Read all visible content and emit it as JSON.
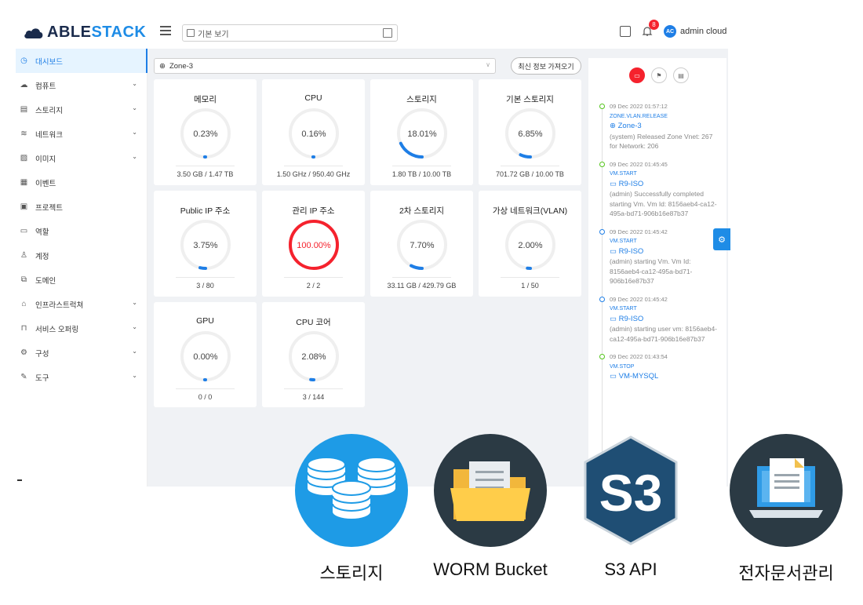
{
  "brand": {
    "logo_part1": "ABLE",
    "logo_part2": "STACK"
  },
  "topbar": {
    "view_label": "기본 보기",
    "notification_count": "8",
    "avatar_initials": "AC",
    "user_name": "admin cloud"
  },
  "sidebar": {
    "items": [
      {
        "label": "대시보드",
        "icon": "dashboard-icon",
        "active": true,
        "expandable": false
      },
      {
        "label": "컴퓨트",
        "icon": "cloud-icon",
        "expandable": true
      },
      {
        "label": "스토리지",
        "icon": "storage-icon",
        "expandable": true
      },
      {
        "label": "네트워크",
        "icon": "wifi-icon",
        "expandable": true
      },
      {
        "label": "이미지",
        "icon": "image-icon",
        "expandable": true
      },
      {
        "label": "이벤트",
        "icon": "calendar-icon",
        "expandable": false
      },
      {
        "label": "프로젝트",
        "icon": "project-icon",
        "expandable": false
      },
      {
        "label": "역할",
        "icon": "role-icon",
        "expandable": false
      },
      {
        "label": "계정",
        "icon": "account-icon",
        "expandable": false
      },
      {
        "label": "도메인",
        "icon": "domain-icon",
        "expandable": false
      },
      {
        "label": "인프라스트럭쳐",
        "icon": "bank-icon",
        "expandable": true
      },
      {
        "label": "서비스 오퍼링",
        "icon": "shopping-icon",
        "expandable": true
      },
      {
        "label": "구성",
        "icon": "gear-icon",
        "expandable": true
      },
      {
        "label": "도구",
        "icon": "tool-icon",
        "expandable": true
      }
    ]
  },
  "main": {
    "zone": "Zone-3",
    "refresh_label": "최신 정보 가져오기",
    "cards": [
      {
        "title": "메모리",
        "value": "0.23%",
        "percent": 0.23,
        "footer": "3.50 GB / 1.47 TB",
        "critical": false
      },
      {
        "title": "CPU",
        "value": "0.16%",
        "percent": 0.16,
        "footer": "1.50 GHz / 950.40 GHz",
        "critical": false
      },
      {
        "title": "스토리지",
        "value": "18.01%",
        "percent": 18.01,
        "footer": "1.80 TB / 10.00 TB",
        "critical": false
      },
      {
        "title": "기본 스토리지",
        "value": "6.85%",
        "percent": 6.85,
        "footer": "701.72 GB / 10.00 TB",
        "critical": false
      },
      {
        "title": "Public IP 주소",
        "value": "3.75%",
        "percent": 3.75,
        "footer": "3 / 80",
        "critical": false
      },
      {
        "title": "관리 IP 주소",
        "value": "100.00%",
        "percent": 100,
        "footer": "2 / 2",
        "critical": true
      },
      {
        "title": "2차 스토리지",
        "value": "7.70%",
        "percent": 7.7,
        "footer": "33.11 GB / 429.79 GB",
        "critical": false
      },
      {
        "title": "가상 네트워크(VLAN)",
        "value": "2.00%",
        "percent": 2,
        "footer": "1 / 50",
        "critical": false
      },
      {
        "title": "GPU",
        "value": "0.00%",
        "percent": 0,
        "footer": "0 / 0",
        "critical": false
      },
      {
        "title": "CPU 코어",
        "value": "2.08%",
        "percent": 2.08,
        "footer": "3 / 144",
        "critical": false
      }
    ]
  },
  "events": {
    "items": [
      {
        "time": "09 Dec 2022 01:57:12",
        "type": "ZONE.VLAN.RELEASE",
        "resource": "Zone-3",
        "desc": "(system) Released Zone Vnet: 267 for Network: 206",
        "status": "green"
      },
      {
        "time": "09 Dec 2022 01:45:45",
        "type": "VM.START",
        "resource": "R9-ISO",
        "desc": "(admin) Successfully completed starting Vm. Vm Id: 8156aeb4-ca12-495a-bd71-906b16e87b37",
        "status": "green"
      },
      {
        "time": "09 Dec 2022 01:45:42",
        "type": "VM.START",
        "resource": "R9-ISO",
        "desc": "(admin) starting Vm. Vm Id: 8156aeb4-ca12-495a-bd71-906b16e87b37",
        "status": "blue"
      },
      {
        "time": "09 Dec 2022 01:45:42",
        "type": "VM.START",
        "resource": "R9-ISO",
        "desc": "(admin) starting user vm: 8156aeb4-ca12-495a-bd71-906b16e87b37",
        "status": "blue"
      },
      {
        "time": "09 Dec 2022 01:43:54",
        "type": "VM.STOP",
        "resource": "VM-MYSQL",
        "desc": "",
        "status": "green"
      }
    ]
  },
  "features": [
    {
      "label": "스토리지",
      "icon": "storage-database-icon",
      "color": "#1e9be6"
    },
    {
      "label": "WORM Bucket",
      "icon": "folder-icon",
      "color": "#2b3a44"
    },
    {
      "label": "S3 API",
      "icon": "s3-icon",
      "color": "#1f4e74"
    },
    {
      "label": "전자문서관리",
      "icon": "laptop-document-icon",
      "color": "#2b3a44"
    }
  ],
  "colors": {
    "accent": "#1e7ee6",
    "critical": "#f5222d",
    "background": "#f0f2f5"
  }
}
